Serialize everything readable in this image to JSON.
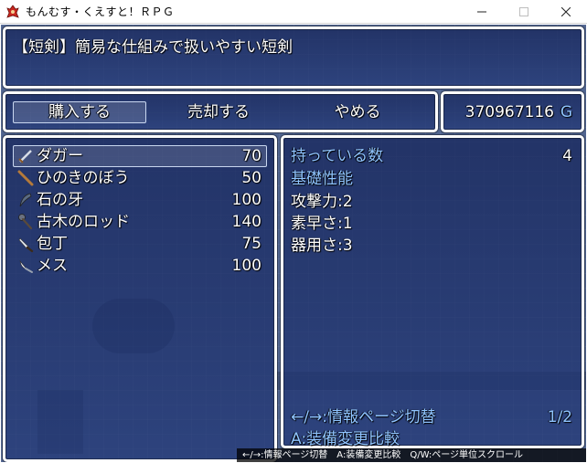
{
  "window": {
    "title": "もんむす・くえすと！ＲＰＧ"
  },
  "help": {
    "text": "【短剣】簡易な仕組みで扱いやすい短剣"
  },
  "commands": {
    "buy": "購入する",
    "sell": "売却する",
    "cancel": "やめる"
  },
  "gold": {
    "amount": "370967116",
    "unit": "G"
  },
  "items": [
    {
      "name": "ダガー",
      "price": "70",
      "icon": "dagger-icon"
    },
    {
      "name": "ひのきのぼう",
      "price": "50",
      "icon": "stick-icon"
    },
    {
      "name": "石の牙",
      "price": "100",
      "icon": "fang-icon"
    },
    {
      "name": "古木のロッド",
      "price": "140",
      "icon": "rod-icon"
    },
    {
      "name": "包丁",
      "price": "75",
      "icon": "kitchen-knife-icon"
    },
    {
      "name": "メス",
      "price": "100",
      "icon": "scalpel-icon"
    }
  ],
  "status": {
    "possession_label": "持っている数",
    "possession_value": "4",
    "section_title": "基礎性能",
    "stats": [
      "攻撃力:2",
      "素早さ:1",
      "器用さ:3"
    ],
    "page_switch_hint": "←/→:情報ページ切替",
    "page_indicator": "1/2",
    "compare_hint": "A:装備変更比較"
  },
  "bottom_help": "←/→:情報ページ切替　A:装備変更比較　Q/W:ページ単位スクロール",
  "colors": {
    "window_bg": "#1c3070",
    "system_text": "#8fc4ff",
    "text": "#ffffff"
  }
}
